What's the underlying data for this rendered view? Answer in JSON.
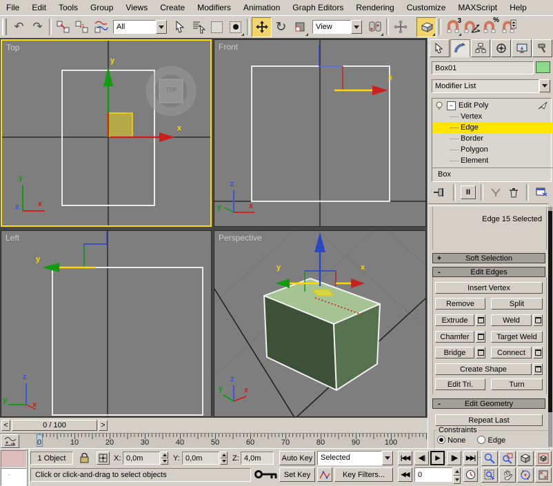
{
  "menu": {
    "items": [
      "File",
      "Edit",
      "Tools",
      "Group",
      "Views",
      "Create",
      "Modifiers",
      "Animation",
      "Graph Editors",
      "Rendering",
      "Customize",
      "MAXScript",
      "Help"
    ]
  },
  "toolbar": {
    "selection_filter": "All",
    "reference_coordsys": "View",
    "snap_3_label": "3",
    "snap_percent_label": "%"
  },
  "viewports": {
    "top_label": "Top",
    "front_label": "Front",
    "left_label": "Left",
    "perspective_label": "Perspective",
    "viewcube_label": "TOP",
    "axis_x": "x",
    "axis_y": "y",
    "axis_z": "z"
  },
  "command_panel": {
    "object_name": "Box01",
    "object_color": "#8cd98c",
    "modifier_dropdown": "Modifier List",
    "stack_modifier": "Edit Poly",
    "stack_items": [
      "Vertex",
      "Edge",
      "Border",
      "Polygon",
      "Element"
    ],
    "stack_selected": "Edge",
    "stack_base": "Box",
    "show_end_result_glyph": "II",
    "selection_status": "Edge 15 Selected",
    "soft_selection_state": "+",
    "soft_selection_title": "Soft Selection",
    "edit_edges_state": "-",
    "edit_edges_title": "Edit Edges",
    "btn_insert_vertex": "Insert Vertex",
    "btn_remove": "Remove",
    "btn_split": "Split",
    "btn_extrude": "Extrude",
    "btn_weld": "Weld",
    "btn_chamfer": "Chamfer",
    "btn_target_weld": "Target Weld",
    "btn_bridge": "Bridge",
    "btn_connect": "Connect",
    "btn_create_shape": "Create Shape",
    "btn_edit_tri": "Edit Tri.",
    "btn_turn": "Turn",
    "edit_geometry_state": "-",
    "edit_geometry_title": "Edit Geometry",
    "btn_repeat_last": "Repeat Last",
    "constraints_legend": "Constraints",
    "constraint_none": "None",
    "constraint_edge": "Edge"
  },
  "timeline": {
    "prev_arrow": "<",
    "next_arrow": ">",
    "slider_label": "0 / 100",
    "ticks": [
      "0",
      "10",
      "20",
      "30",
      "40",
      "50",
      "60",
      "70",
      "80",
      "90",
      "100"
    ]
  },
  "status": {
    "object_count": "1 Object",
    "x_label": "X:",
    "x_value": "0,0m",
    "y_label": "Y:",
    "y_value": "0,0m",
    "z_label": "Z:",
    "z_value": "4,0m",
    "prompt": "Click or click-and-drag to select objects",
    "auto_key": "Auto Key",
    "set_key": "Set Key",
    "key_mode_dropdown": "Selected",
    "key_filters": "Key Filters...",
    "frame_value": "0",
    "playback": {
      "start": "|◀◀",
      "prev": "◀||",
      "play": "▶",
      "next": "||▶",
      "end": "▶▶|",
      "key_mode": "◀◀"
    }
  },
  "colors": {
    "active_viewport_border": "#ffde00",
    "stack_selected_bg": "#ffe400",
    "object_swatch": "#8cd98c",
    "viewport_bg": "#7e7e7e",
    "box_top": "#a6c493",
    "box_front": "#3d5138",
    "box_right": "#56714e"
  }
}
